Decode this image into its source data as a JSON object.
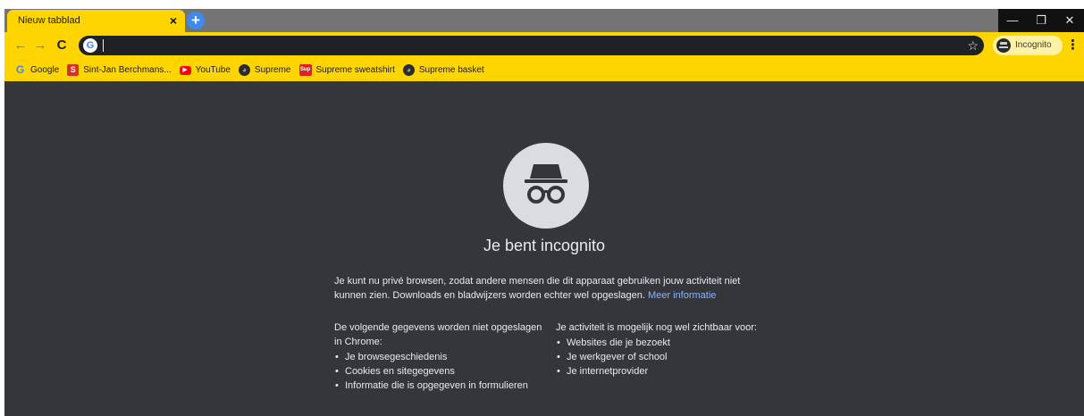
{
  "tab": {
    "title": "Nieuw tabblad",
    "close_glyph": "×"
  },
  "new_tab_glyph": "+",
  "window_controls": {
    "minimize": "—",
    "restore": "❐",
    "close": "✕"
  },
  "toolbar": {
    "back_glyph": "←",
    "forward_glyph": "→",
    "reload_glyph": "C",
    "omnibox_value": "",
    "star_glyph": "☆",
    "profile_label": "Incognito",
    "menu_glyph": "⋮"
  },
  "bookmarks": [
    {
      "label": "Google",
      "icon": "google-icon",
      "glyph": "G"
    },
    {
      "label": "Sint-Jan Berchmans...",
      "icon": "sint-jan-icon",
      "glyph": "S"
    },
    {
      "label": "YouTube",
      "icon": "youtube-icon",
      "glyph": "▶"
    },
    {
      "label": "Supreme",
      "icon": "globe-icon",
      "glyph": "◕"
    },
    {
      "label": "Supreme sweatshirt",
      "icon": "supreme-icon",
      "glyph": "Sup"
    },
    {
      "label": "Supreme basket",
      "icon": "globe-icon",
      "glyph": "◕"
    }
  ],
  "main": {
    "heading": "Je bent incognito",
    "intro": "Je kunt nu privé browsen, zodat andere mensen die dit apparaat gebruiken jouw activiteit niet kunnen zien. Downloads en bladwijzers worden echter wel opgeslagen.",
    "more_link": "Meer informatie",
    "left_title": "De volgende gegevens worden niet opgeslagen in Chrome:",
    "left_items": [
      "Je browsegeschiedenis",
      "Cookies en sitegegevens",
      "Informatie die is opgegeven in formulieren"
    ],
    "right_title": "Je activiteit is mogelijk nog wel zichtbaar voor:",
    "right_items": [
      "Websites die je bezoekt",
      "Je werkgever of school",
      "Je internetprovider"
    ]
  },
  "colors": {
    "theme_yellow": "#ffd500",
    "page_background": "#35363a",
    "link_blue": "#8ab4f8",
    "new_tab_blue": "#3d8af0"
  }
}
